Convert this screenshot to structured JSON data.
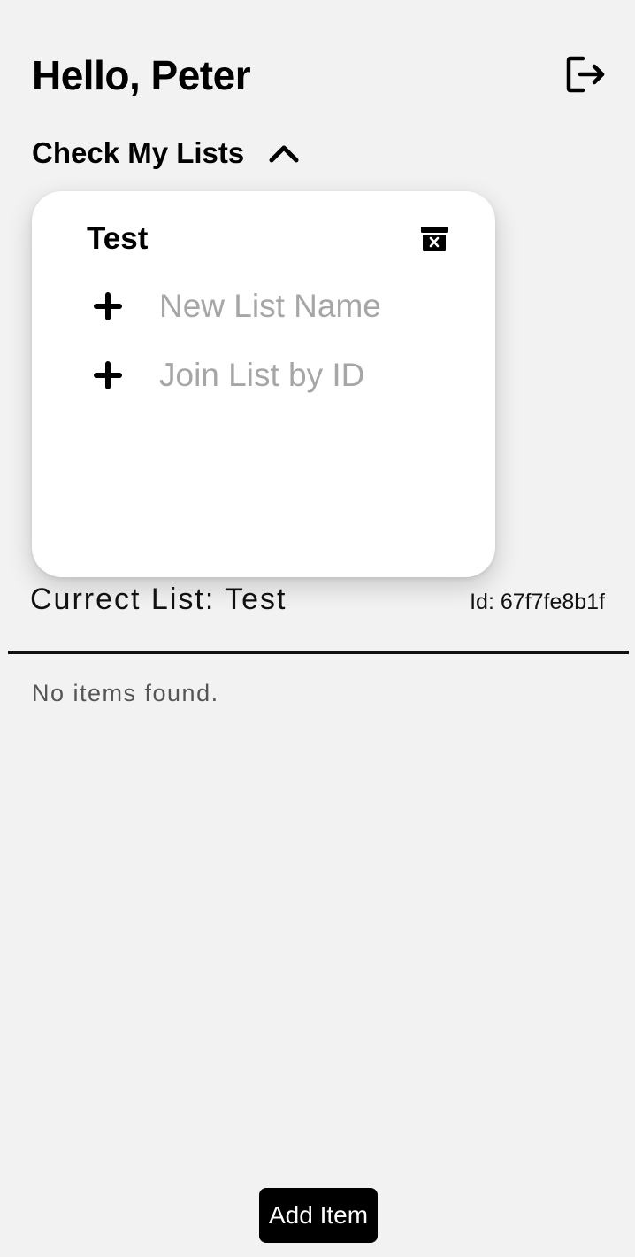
{
  "header": {
    "greeting": "Hello, Peter",
    "logout_icon": "logout-icon"
  },
  "lists_toggle": {
    "label": "Check My Lists",
    "icon": "chevron-up-icon",
    "expanded": true
  },
  "dropdown": {
    "lists": [
      {
        "name": "Test",
        "delete_icon": "archive-x-icon"
      }
    ],
    "new_list": {
      "icon": "plus-icon",
      "placeholder": "New List Name",
      "value": ""
    },
    "join_list": {
      "icon": "plus-icon",
      "placeholder": "Join List by ID",
      "value": ""
    }
  },
  "current_list": {
    "label": "Currect List: Test",
    "id_text": "Id: 67f7fe8b1f"
  },
  "items": {
    "empty_message": "No items found."
  },
  "footer": {
    "add_item_label": "Add Item"
  },
  "colors": {
    "background": "#f2f2f2",
    "card": "#ffffff",
    "text": "#000000",
    "placeholder": "#a6a6a6",
    "button_bg": "#000000",
    "button_text": "#ffffff"
  }
}
